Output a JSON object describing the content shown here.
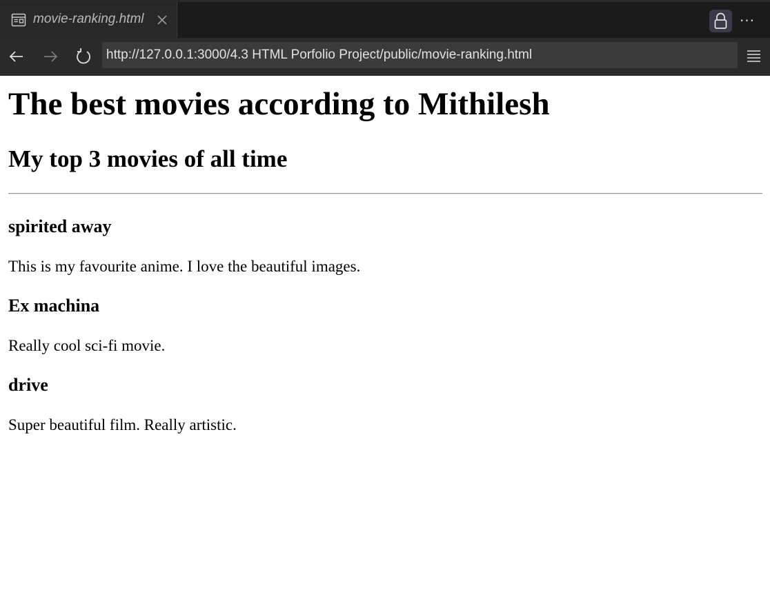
{
  "browser": {
    "tab_title": "movie-ranking.html",
    "url": "http://127.0.0.1:3000/4.3 HTML Porfolio Project/public/movie-ranking.html",
    "more_label": "···",
    "icons": {
      "tab": "page-icon",
      "close": "close-icon",
      "lock": "lock-icon",
      "back": "back-arrow-icon",
      "forward": "forward-arrow-icon",
      "reload": "reload-icon",
      "menu": "hamburger-menu-icon"
    },
    "colors": {
      "tabbar_bg": "#1b1b1b",
      "active_tab_bg": "#282828",
      "navbar_bg": "#2a2a2a",
      "urlbar_bg": "#3b3b3b",
      "lock_button_bg": "#3a3a4a"
    }
  },
  "page": {
    "heading": "The best movies according to Mithilesh",
    "subheading": "My top 3 movies of all time",
    "movies": [
      {
        "title": "spirited away",
        "description": "This is my favourite anime. I love the beautiful images."
      },
      {
        "title": "Ex machina",
        "description": "Really cool sci-fi movie."
      },
      {
        "title": "drive",
        "description": "Super beautiful film. Really artistic."
      }
    ]
  }
}
